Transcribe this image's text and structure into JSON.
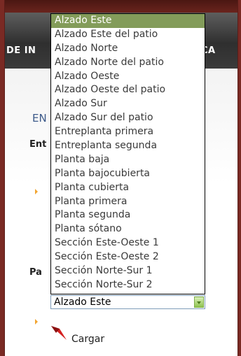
{
  "header": {
    "title_left": "DE IN",
    "title_right": "CA"
  },
  "section": {
    "title_fragment": "EN"
  },
  "labels": {
    "first": "Ent",
    "second": "Pa"
  },
  "plan_select": {
    "value": "Alzado Este",
    "options": [
      "Alzado Este",
      "Alzado Este del patio",
      "Alzado Norte",
      "Alzado Norte del patio",
      "Alzado Oeste",
      "Alzado Oeste del patio",
      "Alzado Sur",
      "Alzado Sur del patio",
      "Entreplanta primera",
      "Entreplanta segunda",
      "Planta baja",
      "Planta bajocubierta",
      "Planta cubierta",
      "Planta primera",
      "Planta segunda",
      "Planta sótano",
      "Sección Este-Oeste 1",
      "Sección Este-Oeste 2",
      "Sección Norte-Sur 1",
      "Sección Norte-Sur 2"
    ],
    "highlighted_index": 0
  },
  "actions": {
    "load_label": "Cargar"
  },
  "colors": {
    "frame": "#7a2a24",
    "header": "#3b3b3b",
    "highlight": "#839c5a",
    "title": "#3d5a8a",
    "bullet": "#f2a531",
    "cargar_icon": "#d42020"
  },
  "icons": {
    "load": "red-arrow-icon",
    "bullet": "orange-triangle-bullet-icon"
  }
}
